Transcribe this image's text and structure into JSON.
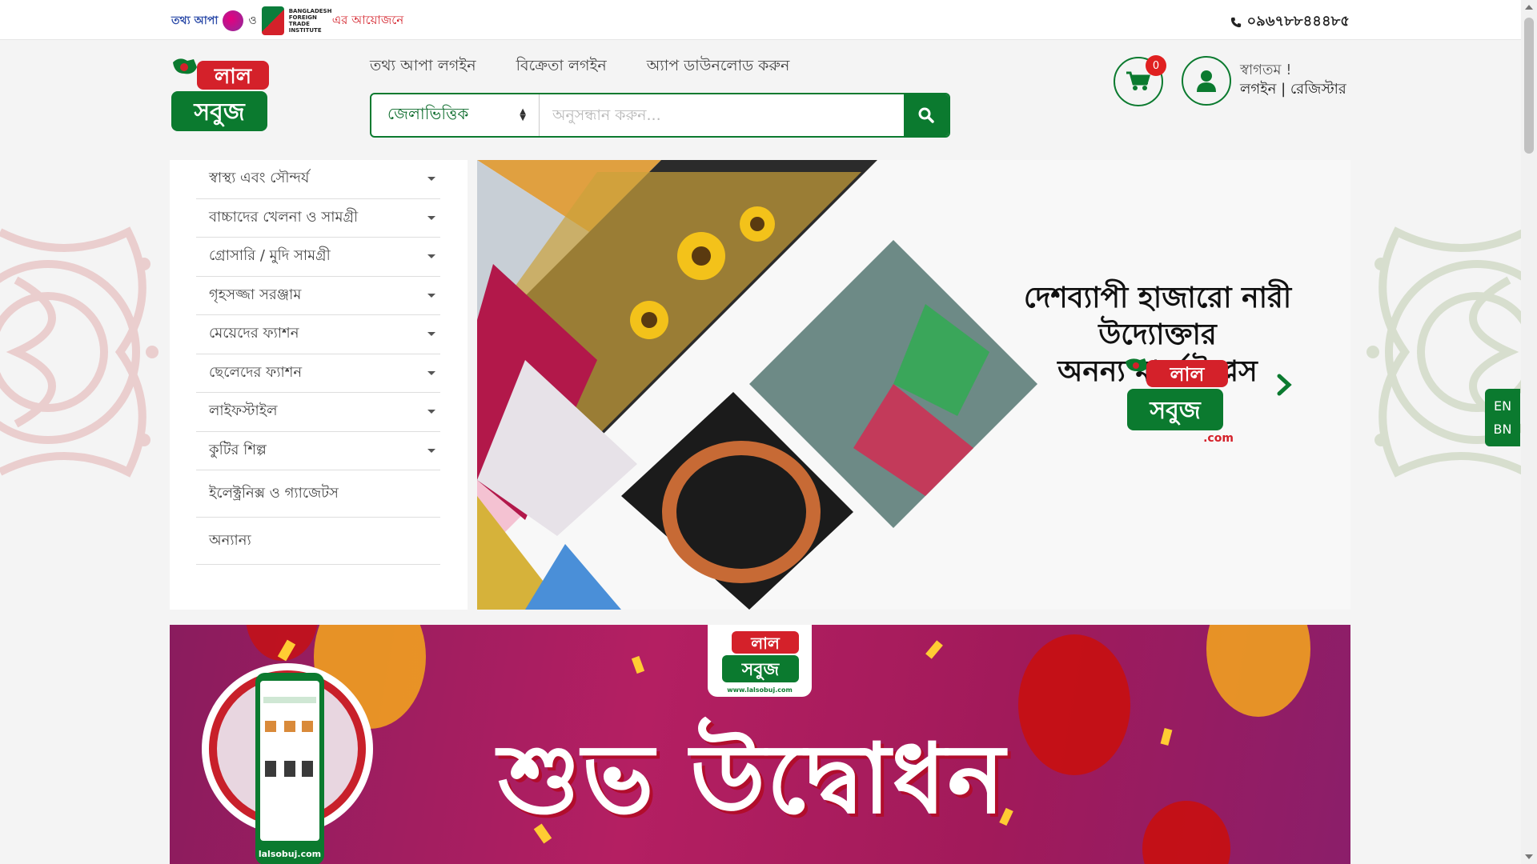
{
  "topbar": {
    "sponsor_tottho": "তথ্য আপা",
    "sponsor_and": "ও",
    "sponsor_bfti": "BANGLADESH FOREIGN TRADE INSTITUTE",
    "sponsor_org": "এর আয়োজনে",
    "phone": "০৯৬৭৮৮৪৪৪৮৫"
  },
  "brand": {
    "logo_top": "লাল",
    "logo_bottom": "সবুজ"
  },
  "nav": {
    "items": [
      {
        "label": "তথ্য আপা লগইন"
      },
      {
        "label": "বিক্রেতা লগইন"
      },
      {
        "label": "অ্যাপ ডাউনলোড করুন"
      }
    ]
  },
  "search": {
    "category_value": "জেলাভিত্তিক",
    "placeholder": "অনুসন্ধান করুন..."
  },
  "cart": {
    "count": "0"
  },
  "account": {
    "welcome": "স্বাগতম !",
    "login": "লগইন",
    "separator": "|",
    "register": "রেজিস্টার"
  },
  "categories": [
    {
      "label": "স্বাস্থ্য এবং সৌন্দর্য",
      "has_sub": true
    },
    {
      "label": "বাচ্চাদের খেলনা ও সামগ্রী",
      "has_sub": true
    },
    {
      "label": "গ্রোসারি / মুদি সামগ্রী",
      "has_sub": true
    },
    {
      "label": "গৃহসজ্জা সরঞ্জাম",
      "has_sub": true
    },
    {
      "label": "মেয়েদের ফ্যাশন",
      "has_sub": true
    },
    {
      "label": "ছেলেদের ফ্যাশন",
      "has_sub": true
    },
    {
      "label": "লাইফস্টাইল",
      "has_sub": true
    },
    {
      "label": "কুটির শিল্প",
      "has_sub": true
    },
    {
      "label": "ইলেক্ট্রনিক্স ও গ্যাজেটস",
      "has_sub": false
    },
    {
      "label": "অন্যান্য",
      "has_sub": false
    }
  ],
  "banner": {
    "line1": "দেশব্যাপী হাজারো নারী উদ্যোক্তার",
    "line2": "অনন্য মার্কেটপ্লেস",
    "logo_top": "লাল",
    "logo_bottom": "সবুজ",
    "logo_domain": ".com"
  },
  "lang": {
    "en": "EN",
    "bn": "BN"
  },
  "promo": {
    "headline": "শুভ উদ্বোধন",
    "logo_top": "লাল",
    "logo_bottom": "সবুজ",
    "logo_url": "www.lalsobuj.com",
    "phone_caption": "lalsobuj.com"
  },
  "colors": {
    "brand_green": "#0b7a2f",
    "brand_red": "#d4212a",
    "promo_bg": "#a11a5a"
  }
}
